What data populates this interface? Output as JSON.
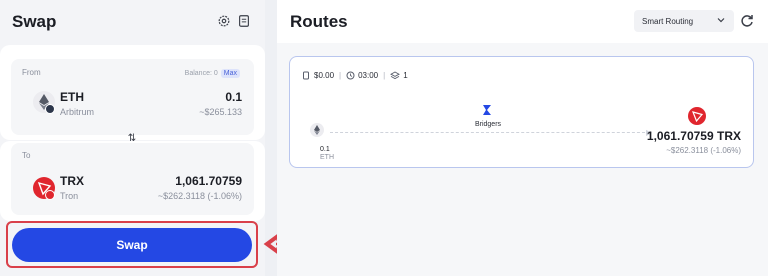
{
  "swap": {
    "title": "Swap",
    "from": {
      "label": "From",
      "balance_label": "Balance: 0",
      "max_label": "Max",
      "symbol": "ETH",
      "chain": "Arbitrum",
      "amount": "0.1",
      "usd": "~$265.133"
    },
    "to": {
      "label": "To",
      "symbol": "TRX",
      "chain": "Tron",
      "amount": "1,061.70759",
      "usd": "~$262.3118 (-1.06%)"
    },
    "button_label": "Swap"
  },
  "routes": {
    "title": "Routes",
    "routing_select": "Smart Routing",
    "route": {
      "fee": "$0.00",
      "time": "03:00",
      "steps": "1",
      "bridge_name": "Bridgers",
      "from_amount": "0.1",
      "from_symbol": "ETH",
      "to_amount": "1,061.70759 TRX",
      "to_usd": "~$262.3118 (-1.06%)"
    }
  },
  "colors": {
    "accent": "#2448e4",
    "highlight": "#d9404a",
    "tron_red": "#e0262e"
  }
}
